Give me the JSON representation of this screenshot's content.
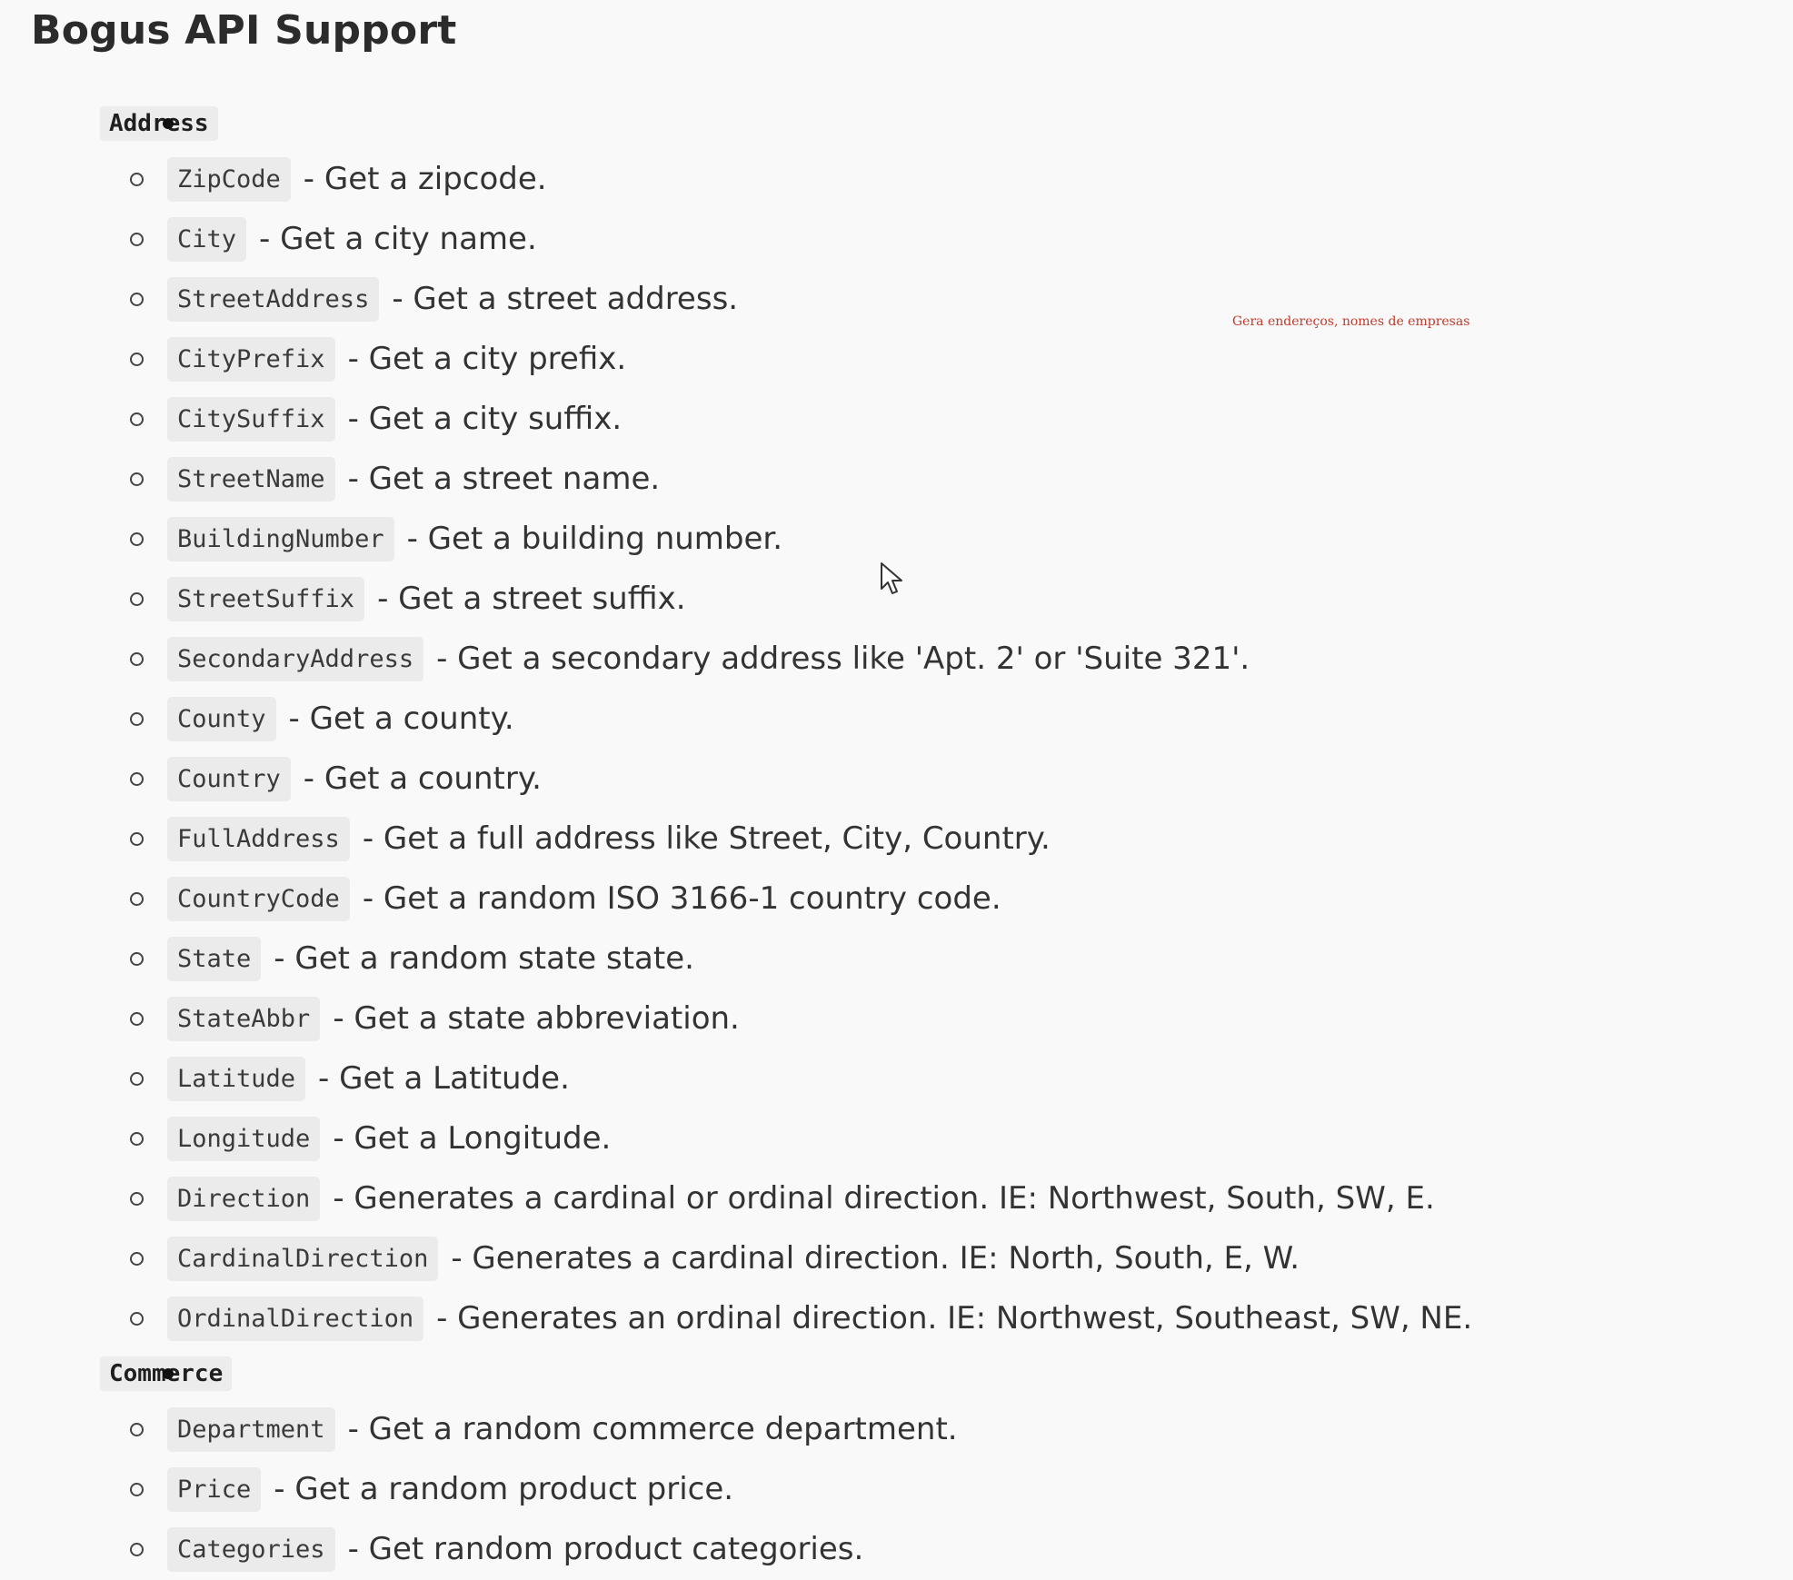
{
  "title": "Bogus API Support",
  "annotation": "Gera endereços, nomes de empresas",
  "sections": [
    {
      "name": "Address",
      "items": [
        {
          "code": "ZipCode",
          "desc": "- Get a zipcode."
        },
        {
          "code": "City",
          "desc": "- Get a city name."
        },
        {
          "code": "StreetAddress",
          "desc": "- Get a street address."
        },
        {
          "code": "CityPrefix",
          "desc": "- Get a city prefix."
        },
        {
          "code": "CitySuffix",
          "desc": "- Get a city suffix."
        },
        {
          "code": "StreetName",
          "desc": "- Get a street name."
        },
        {
          "code": "BuildingNumber",
          "desc": "- Get a building number."
        },
        {
          "code": "StreetSuffix",
          "desc": "- Get a street suffix."
        },
        {
          "code": "SecondaryAddress",
          "desc": "- Get a secondary address like 'Apt. 2' or 'Suite 321'."
        },
        {
          "code": "County",
          "desc": "- Get a county."
        },
        {
          "code": "Country",
          "desc": "- Get a country."
        },
        {
          "code": "FullAddress",
          "desc": "- Get a full address like Street, City, Country."
        },
        {
          "code": "CountryCode",
          "desc": "- Get a random ISO 3166-1 country code."
        },
        {
          "code": "State",
          "desc": "- Get a random state state."
        },
        {
          "code": "StateAbbr",
          "desc": "- Get a state abbreviation."
        },
        {
          "code": "Latitude",
          "desc": "- Get a Latitude."
        },
        {
          "code": "Longitude",
          "desc": "- Get a Longitude."
        },
        {
          "code": "Direction",
          "desc": "- Generates a cardinal or ordinal direction. IE: Northwest, South, SW, E."
        },
        {
          "code": "CardinalDirection",
          "desc": "- Generates a cardinal direction. IE: North, South, E, W."
        },
        {
          "code": "OrdinalDirection",
          "desc": "- Generates an ordinal direction. IE: Northwest, Southeast, SW, NE."
        }
      ]
    },
    {
      "name": "Commerce",
      "items": [
        {
          "code": "Department",
          "desc": "- Get a random commerce department."
        },
        {
          "code": "Price",
          "desc": "- Get a random product price."
        },
        {
          "code": "Categories",
          "desc": "- Get random product categories."
        }
      ]
    }
  ],
  "icons": {
    "cursor": "mouse-pointer-icon"
  }
}
